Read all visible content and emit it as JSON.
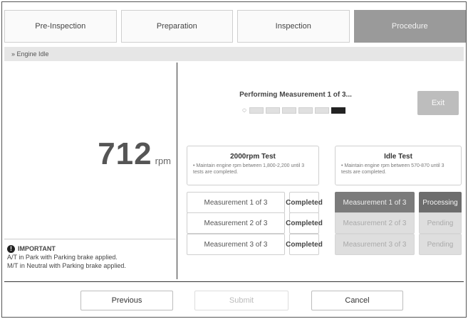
{
  "tabs": [
    {
      "label": "Pre-Inspection"
    },
    {
      "label": "Preparation"
    },
    {
      "label": "Inspection"
    },
    {
      "label": "Procedure"
    }
  ],
  "breadcrumb": "» Engine Idle",
  "rpm": {
    "value": "712",
    "unit": "rpm"
  },
  "important": {
    "title": "IMPORTANT",
    "lines": [
      "A/T in Park with Parking brake applied.",
      "M/T in Neutral with Parking brake applied."
    ]
  },
  "measurement": {
    "performing": "Performing Measurement 1 of 3...",
    "progress_segments": 6,
    "progress_filled": 1
  },
  "exit_label": "Exit",
  "test_2000": {
    "title": "2000rpm Test",
    "desc": "• Maintain engine rpm between 1,800-2,200 until 3 tests are completed.",
    "rows": [
      {
        "label": "Measurement 1 of 3",
        "status": "Completed"
      },
      {
        "label": "Measurement 2 of 3",
        "status": "Completed"
      },
      {
        "label": "Measurement 3 of 3",
        "status": "Completed"
      }
    ]
  },
  "test_idle": {
    "title": "Idle Test",
    "desc": "• Maintain engine rpm between 570-870 until 3 tests are completed.",
    "rows": [
      {
        "label": "Measurement 1 of 3",
        "status": "Processing"
      },
      {
        "label": "Measurement 2 of 3",
        "status": "Pending"
      },
      {
        "label": "Measurement 3 of 3",
        "status": "Pending"
      }
    ]
  },
  "nav": {
    "previous": "Previous",
    "submit": "Submit",
    "cancel": "Cancel"
  }
}
